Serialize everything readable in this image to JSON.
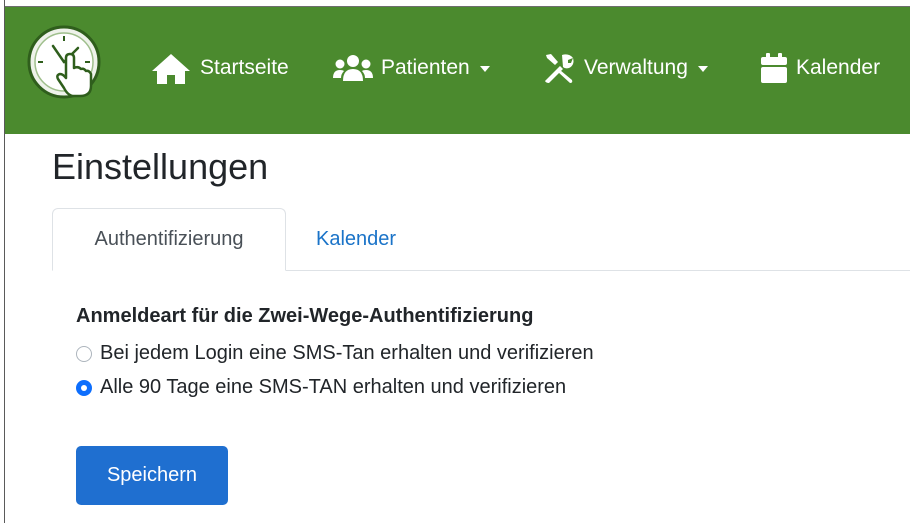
{
  "navbar": {
    "logo_icon": "clock-hand-logo",
    "items": [
      {
        "label": "Startseite",
        "icon": "home-icon",
        "dropdown": false
      },
      {
        "label": "Patienten",
        "icon": "users-icon",
        "dropdown": true
      },
      {
        "label": "Verwaltung",
        "icon": "tools-icon",
        "dropdown": true
      },
      {
        "label": "Kalender",
        "icon": "calendar-icon",
        "dropdown": false
      }
    ],
    "background_color": "#4b8a2e"
  },
  "page": {
    "title": "Einstellungen"
  },
  "tabs": [
    {
      "label": "Authentifizierung",
      "active": true
    },
    {
      "label": "Kalender",
      "active": false
    }
  ],
  "auth_settings": {
    "heading": "Anmeldeart für die Zwei-Wege-Authentifizierung",
    "options": [
      {
        "label": "Bei jedem Login eine SMS-Tan erhalten und verifizieren",
        "selected": false
      },
      {
        "label": "Alle 90 Tage eine SMS-TAN erhalten und verifizieren",
        "selected": true
      }
    ]
  },
  "actions": {
    "save_label": "Speichern"
  },
  "colors": {
    "accent": "#1f6fd0",
    "link": "#1a73c8"
  }
}
